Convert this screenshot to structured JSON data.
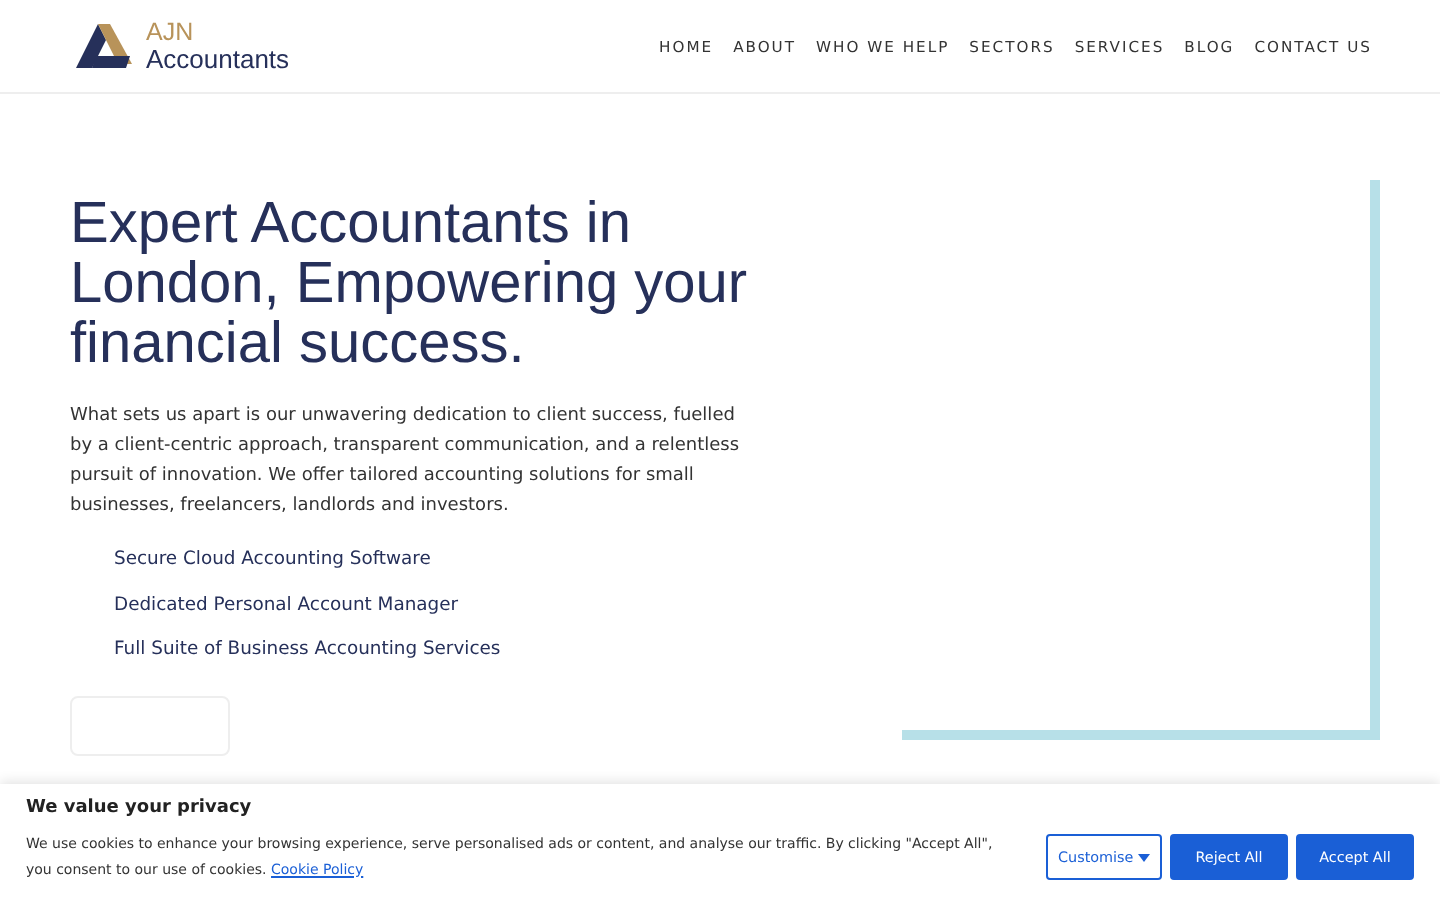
{
  "header": {
    "logo": {
      "line1": "AJN",
      "line2": "Accountants"
    },
    "nav": [
      {
        "label": "HOME"
      },
      {
        "label": "ABOUT"
      },
      {
        "label": "WHO WE HELP"
      },
      {
        "label": "SECTORS"
      },
      {
        "label": "SERVICES"
      },
      {
        "label": "BLOG"
      },
      {
        "label": "CONTACT US"
      }
    ]
  },
  "hero": {
    "heading": "Expert Accountants in London, Empowering your financial success.",
    "body": "What sets us apart is our unwavering dedication to client success, fuelled by a client-centric approach, transparent communication, and a relentless pursuit of innovation. We offer tailored accounting solutions for small businesses, freelancers, landlords and investors.",
    "features": [
      "Secure Cloud Accounting Software",
      "Dedicated Personal Account Manager",
      "Full Suite of Business Accounting Services"
    ]
  },
  "cookie_banner": {
    "title": "We value your privacy",
    "text": "We use cookies to enhance your browsing experience, serve personalised ads or content, and analyse our traffic. By clicking \"Accept All\", you consent to our use of cookies.",
    "link": "Cookie Policy",
    "buttons": [
      {
        "label": "Customise",
        "kind": "outline"
      },
      {
        "label": "Reject All",
        "kind": "solid"
      },
      {
        "label": "Accept All",
        "kind": "solid"
      }
    ]
  }
}
